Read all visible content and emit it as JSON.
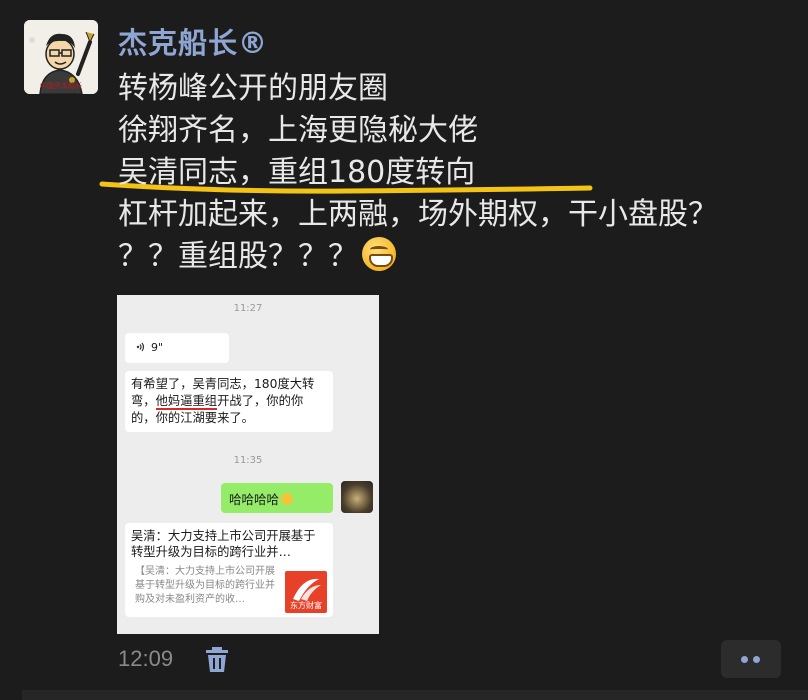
{
  "post": {
    "username": "杰克船长®",
    "avatar_caption": "中国资本船长",
    "lines": [
      "转杨峰公开的朋友圈",
      "徐翔齐名，上海更隐秘大佬",
      "吴清同志，重组180度转向",
      "杠杆加起来，上两融，场外期权，干小盘股？",
      "？？重组股？？？"
    ],
    "time": "12:09",
    "highlight_color": "#f3c316"
  },
  "screenshot": {
    "timestamp_1": "11:27",
    "voice_duration": "9\"",
    "msg1_a": "有希望了，吴青同志，180度大转弯，",
    "msg1_underlined": "他妈逼重组",
    "msg1_b": "开战了，你的你的，你的江湖要来了。",
    "timestamp_2": "11:35",
    "reply": "哈哈哈哈",
    "link_title": "吴清：大力支持上市公司开展基于转型升级为目标的跨行业并…",
    "link_desc": "【吴清：大力支持上市公司开展基于转型升级为目标的跨行业并购及对未盈利资产的收…",
    "logo_text": "东方财富"
  },
  "icons": {
    "trash": "trash-icon",
    "more": "more-dots-icon",
    "emoji": "grinning-face-emoji"
  }
}
